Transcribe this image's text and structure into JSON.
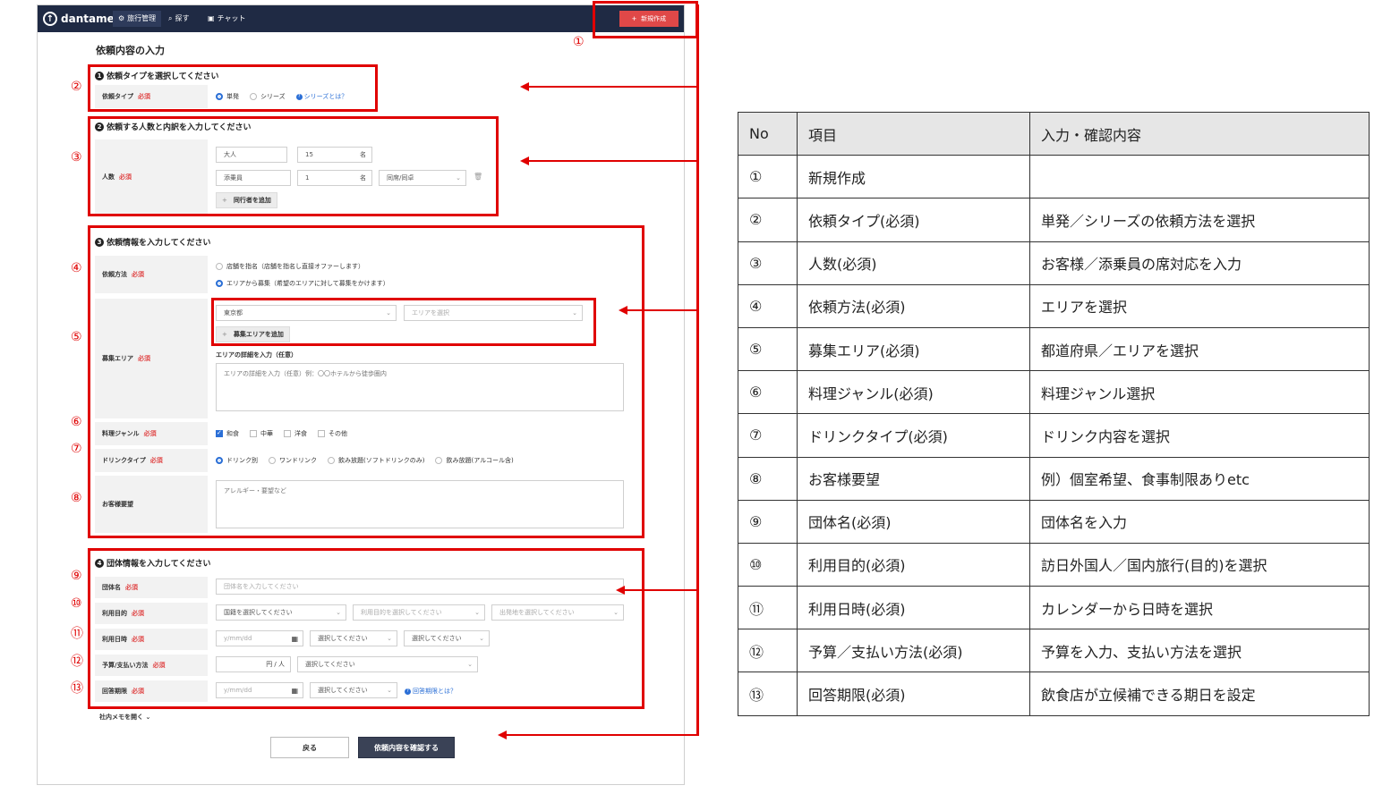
{
  "app": {
    "logo": "dantame",
    "nav": [
      {
        "label": "旅行管理",
        "icon": "gear-icon"
      },
      {
        "label": "探す",
        "icon": "search-icon"
      },
      {
        "label": "チャット",
        "icon": "chat-icon"
      }
    ],
    "new_button": "新規作成",
    "page_title": "依頼内容の入力",
    "required": "必須",
    "sections": {
      "s1": {
        "num": "1",
        "title": "依頼タイプを選択してください"
      },
      "s2": {
        "num": "2",
        "title": "依頼する人数と内訳を入力してください"
      },
      "s3": {
        "num": "3",
        "title": "依頼情報を入力してください"
      },
      "s4": {
        "num": "4",
        "title": "団体情報を入力してください"
      }
    },
    "request_type": {
      "label": "依頼タイプ",
      "options": [
        "単発",
        "シリーズ"
      ],
      "selected": "単発",
      "help": "シリーズとは？"
    },
    "people": {
      "label": "人数",
      "row1": {
        "type": "大人",
        "count": "15",
        "unit": "名"
      },
      "row2": {
        "type": "添乗員",
        "count": "1",
        "unit": "名",
        "seating": "同席/同卓"
      },
      "add_button": "同行者を追加"
    },
    "request_method": {
      "label": "依頼方法",
      "options": [
        "店舗を指名（店舗を指名し直接オファーします）",
        "エリアから募集（希望のエリアに対して募集をかけます）"
      ],
      "selected_index": 1
    },
    "area": {
      "label": "募集エリア",
      "prefecture": "東京都",
      "area_placeholder": "エリアを選択",
      "add_button": "募集エリアを追加",
      "detail_label": "エリアの詳細を入力（任意）",
      "detail_placeholder": "エリアの詳細を入力（任意）例：〇〇ホテルから徒歩圏内"
    },
    "cuisine": {
      "label": "料理ジャンル",
      "options": [
        "和食",
        "中華",
        "洋食",
        "その他"
      ],
      "checked": [
        true,
        false,
        false,
        false
      ]
    },
    "drink": {
      "label": "ドリンクタイプ",
      "options": [
        "ドリンク別",
        "ワンドリンク",
        "飲み放題(ソフトドリンクのみ)",
        "飲み放題(アルコール含)"
      ],
      "selected_index": 0
    },
    "customer_request": {
      "label": "お客様要望",
      "placeholder": "アレルギー・要望など"
    },
    "group_name": {
      "label": "団体名",
      "placeholder": "団体名を入力してください"
    },
    "purpose": {
      "label": "利用目的",
      "select1": "国籍を選択してください",
      "select2": "利用目的を選択してください",
      "select3": "出発地を選択してください"
    },
    "datetime": {
      "label": "利用日時",
      "date_placeholder": "y/mm/dd",
      "select1": "選択してください",
      "select2": "選択してください"
    },
    "budget": {
      "label": "予算/支払い方法",
      "unit": "円 / 人",
      "payment": "選択してください"
    },
    "deadline": {
      "label": "回答期限",
      "date_placeholder": "y/mm/dd",
      "select": "選択してください",
      "help": "回答期限とは？"
    },
    "memo_toggle": "社内メモを開く",
    "back_button": "戻る",
    "confirm_button": "依頼内容を確認する"
  },
  "markers": [
    "①",
    "②",
    "③",
    "④",
    "⑤",
    "⑥",
    "⑦",
    "⑧",
    "⑨",
    "⑩",
    "⑪",
    "⑫",
    "⑬"
  ],
  "table": {
    "headers": [
      "No",
      "項目",
      "入力・確認内容"
    ],
    "rows": [
      [
        "①",
        "新規作成",
        ""
      ],
      [
        "②",
        "依頼タイプ(必須)",
        "単発／シリーズの依頼方法を選択"
      ],
      [
        "③",
        "人数(必須)",
        "お客様／添乗員の席対応を入力"
      ],
      [
        "④",
        "依頼方法(必須)",
        "エリアを選択"
      ],
      [
        "⑤",
        "募集エリア(必須)",
        "都道府県／エリアを選択"
      ],
      [
        "⑥",
        "料理ジャンル(必須)",
        "料理ジャンル選択"
      ],
      [
        "⑦",
        "ドリンクタイプ(必須)",
        "ドリンク内容を選択"
      ],
      [
        "⑧",
        "お客様要望",
        "例）個室希望、食事制限ありetc"
      ],
      [
        "⑨",
        "団体名(必須)",
        "団体名を入力"
      ],
      [
        "⑩",
        "利用目的(必須)",
        "訪日外国人／国内旅行(目的)を選択"
      ],
      [
        "⑪",
        "利用日時(必須)",
        "カレンダーから日時を選択"
      ],
      [
        "⑫",
        "予算／支払い方法(必須)",
        "予算を入力、支払い方法を選択"
      ],
      [
        "⑬",
        "回答期限(必須)",
        "飲食店が立候補できる期日を設定"
      ]
    ]
  },
  "colors": {
    "accent_red": "#e00000",
    "navbar": "#1f2a44",
    "primary_blue": "#2b6fd6",
    "new_button": "#e04848"
  }
}
